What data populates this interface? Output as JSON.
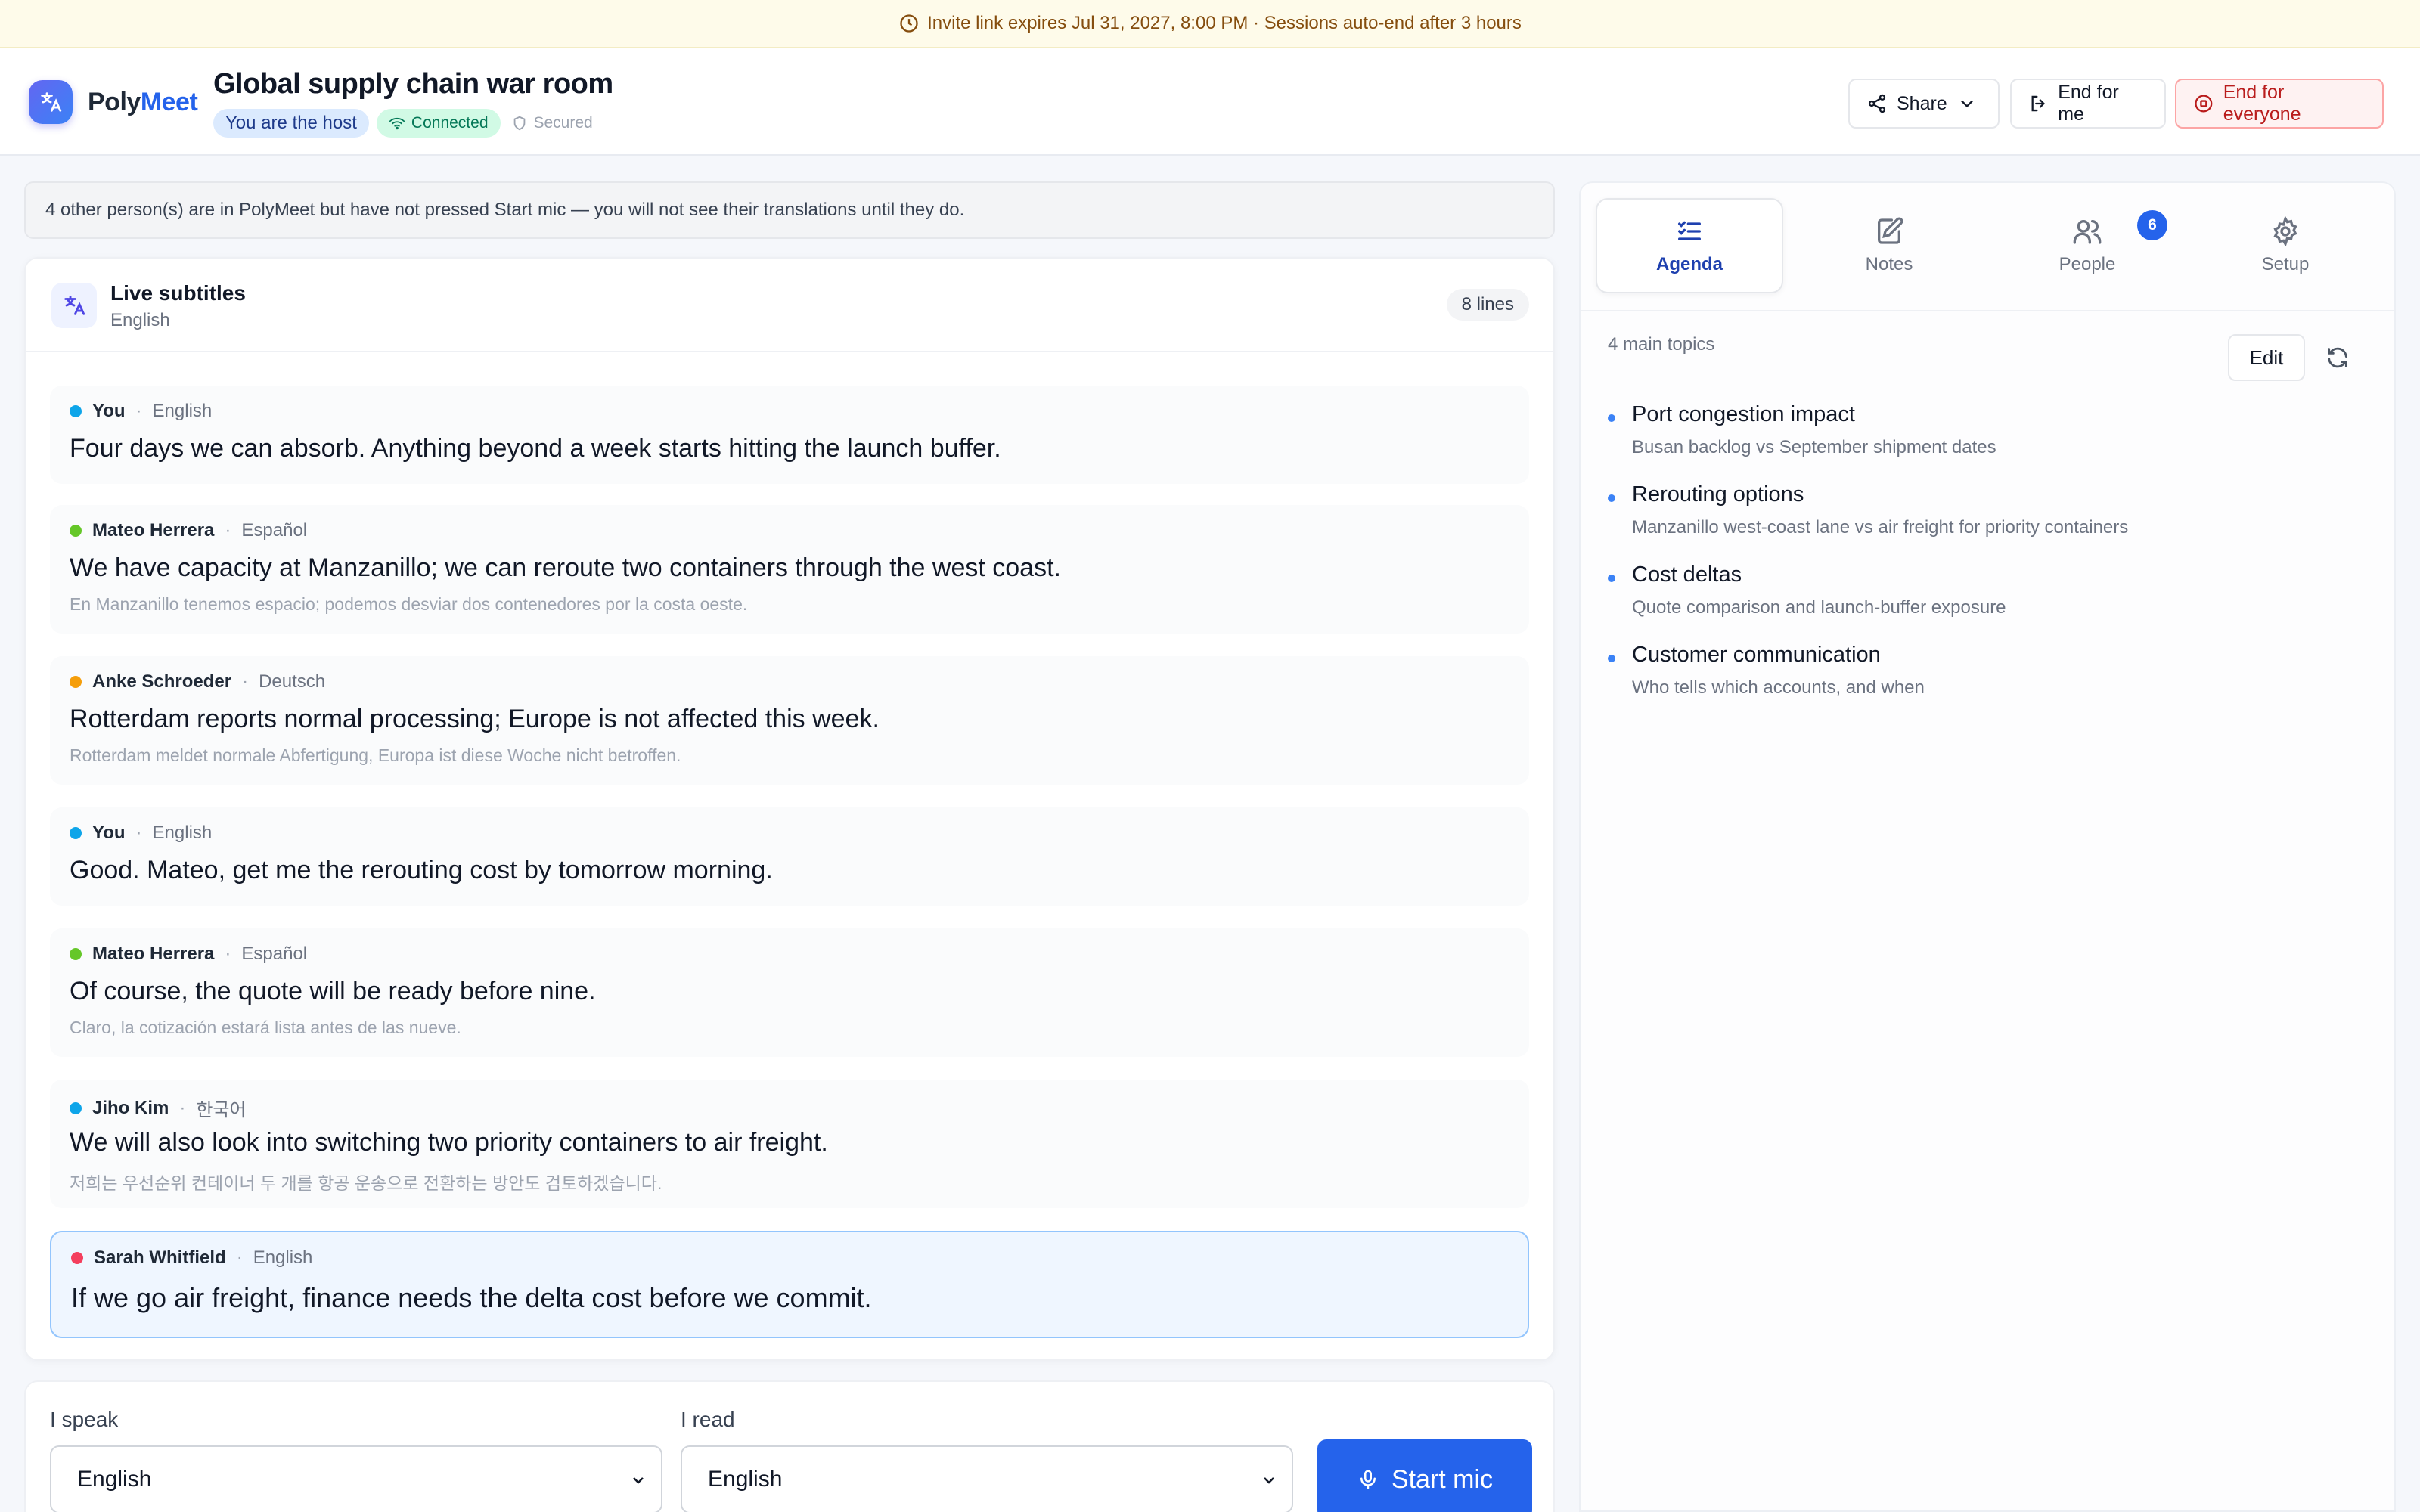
{
  "banner": {
    "text": "Invite link expires Jul 31, 2027, 8:00 PM · Sessions auto-end after 3 hours"
  },
  "header": {
    "logo": {
      "poly": "Poly",
      "meet": "Meet"
    },
    "room_title": "Global supply chain war room",
    "chips": {
      "host": "You are the host",
      "connected": "Connected",
      "secured": "Secured"
    },
    "buttons": {
      "share": "Share",
      "end_for_me": "End for me",
      "end_for_everyone": "End for everyone"
    }
  },
  "notice": "4 other person(s) are in PolyMeet but have not pressed Start mic — you will not see their translations until they do.",
  "subtitles": {
    "title": "Live subtitles",
    "language": "English",
    "line_count": "8 lines",
    "messages": [
      {
        "speaker": "You",
        "language": "English",
        "text": "Four days we can absorb. Anything beyond a week starts hitting the launch buffer.",
        "original": "",
        "color": "#0ea5e9"
      },
      {
        "speaker": "Mateo Herrera",
        "language": "Español",
        "text": "We have capacity at Manzanillo; we can reroute two containers through the west coast.",
        "original": "En Manzanillo tenemos espacio; podemos desviar dos contenedores por la costa oeste.",
        "color": "#65c728"
      },
      {
        "speaker": "Anke Schroeder",
        "language": "Deutsch",
        "text": "Rotterdam reports normal processing; Europe is not affected this week.",
        "original": "Rotterdam meldet normale Abfertigung, Europa ist diese Woche nicht betroffen.",
        "color": "#f59e0b"
      },
      {
        "speaker": "You",
        "language": "English",
        "text": "Good. Mateo, get me the rerouting cost by tomorrow morning.",
        "original": "",
        "color": "#0ea5e9"
      },
      {
        "speaker": "Mateo Herrera",
        "language": "Español",
        "text": "Of course, the quote will be ready before nine.",
        "original": "Claro, la cotización estará lista antes de las nueve.",
        "color": "#65c728"
      },
      {
        "speaker": "Jiho Kim",
        "language": "한국어",
        "text": "We will also look into switching two priority containers to air freight.",
        "original": "저희는 우선순위 컨테이너 두 개를 항공 운송으로 전환하는 방안도 검토하겠습니다.",
        "color": "#0ea5e9"
      },
      {
        "speaker": "Sarah Whitfield",
        "language": "English",
        "text": "If we go air freight, finance needs the delta cost before we commit.",
        "original": "",
        "color": "#f43f5e"
      }
    ]
  },
  "controls": {
    "speak_label": "I speak",
    "speak_value": "English",
    "read_label": "I read",
    "read_value": "English",
    "start_mic": "Start mic"
  },
  "sidebar": {
    "tabs": [
      {
        "label": "Agenda",
        "icon": "list-check-icon",
        "active": true
      },
      {
        "label": "Notes",
        "icon": "note-edit-icon",
        "active": false
      },
      {
        "label": "People",
        "icon": "people-icon",
        "active": false,
        "badge": "6"
      },
      {
        "label": "Setup",
        "icon": "gear-icon",
        "active": false
      }
    ],
    "topic_count": "4 main topics",
    "edit_label": "Edit",
    "topics": [
      {
        "title": "Port congestion impact",
        "subtitle": "Busan backlog vs September shipment dates"
      },
      {
        "title": "Rerouting options",
        "subtitle": "Manzanillo west-coast lane vs air freight for priority containers"
      },
      {
        "title": "Cost deltas",
        "subtitle": "Quote comparison and launch-buffer exposure"
      },
      {
        "title": "Customer communication",
        "subtitle": "Who tells which accounts, and when"
      }
    ]
  },
  "colors": {
    "accent": "#2563eb",
    "danger": "#b91c1c",
    "banner_bg": "#fefbea"
  }
}
